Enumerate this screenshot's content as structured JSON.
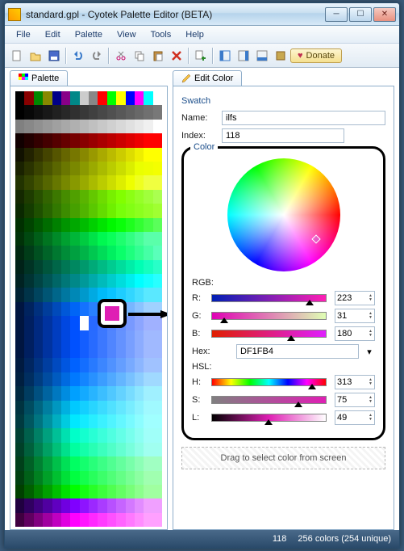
{
  "window": {
    "title": "standard.gpl - Cyotek Palette Editor (BETA)"
  },
  "menu": [
    "File",
    "Edit",
    "Palette",
    "View",
    "Tools",
    "Help"
  ],
  "toolbar": {
    "donate": "Donate"
  },
  "tabs": {
    "palette": "Palette",
    "editcolor": "Edit Color"
  },
  "swatch": {
    "group": "Swatch",
    "name_label": "Name:",
    "name_value": "ilfs",
    "index_label": "Index:",
    "index_value": "118"
  },
  "color": {
    "group": "Color",
    "rgb_label": "RGB:",
    "r_label": "R:",
    "r_value": "223",
    "g_label": "G:",
    "g_value": "31",
    "b_label": "B:",
    "b_value": "180",
    "hex_label": "Hex:",
    "hex_value": "DF1FB4",
    "hsl_label": "HSL:",
    "h_label": "H:",
    "h_value": "313",
    "s_label": "S:",
    "s_value": "75",
    "l_label": "L:",
    "l_value": "49",
    "drag_text": "Drag to select color from screen"
  },
  "status": {
    "index": "118",
    "summary": "256 colors (254 unique)"
  },
  "palette_rows": [
    [
      "#000",
      "#800",
      "#080",
      "#880",
      "#008",
      "#808",
      "#088",
      "#ccc",
      "#888",
      "#f00",
      "#0f0",
      "#ff0",
      "#00f",
      "#f0f",
      "#0ff",
      "#fff"
    ],
    [
      "#000",
      "#080808",
      "#101010",
      "#181818",
      "#202020",
      "#282828",
      "#303030",
      "#383838",
      "#404040",
      "#484848",
      "#505050",
      "#585858",
      "#606060",
      "#686868",
      "#707070",
      "#787878"
    ],
    [
      "#808080",
      "#888",
      "#909090",
      "#989898",
      "#a0a0a0",
      "#a8a8a8",
      "#b0b0b0",
      "#b8b8b8",
      "#c0c0c0",
      "#c8c8c8",
      "#d0d0d0",
      "#d8d8d8",
      "#e0e0e0",
      "#e8e8e8",
      "#f0f0f0",
      "#fff"
    ],
    [
      "#100",
      "#200",
      "#300",
      "#400",
      "#500",
      "#600",
      "#700",
      "#800",
      "#900",
      "#a00",
      "#b00",
      "#c00",
      "#d00",
      "#e00",
      "#f00",
      "#f00"
    ],
    [
      "#110",
      "#220",
      "#330",
      "#440",
      "#550",
      "#660",
      "#770",
      "#880",
      "#990",
      "#aa0",
      "#bb0",
      "#cc0",
      "#dd0",
      "#ee0",
      "#ff0",
      "#ff0"
    ],
    [
      "#1a2200",
      "#2a3300",
      "#3a4400",
      "#4a5500",
      "#5a6600",
      "#6a7700",
      "#7a8800",
      "#8a9900",
      "#9aaa00",
      "#aabb00",
      "#bacc00",
      "#cadd00",
      "#daee00",
      "#eaff00",
      "#efff00",
      "#f4ff00"
    ],
    [
      "#223300",
      "#334400",
      "#445500",
      "#556600",
      "#667700",
      "#778800",
      "#889900",
      "#99aa00",
      "#aabb00",
      "#bbcc00",
      "#ccdd00",
      "#ddee00",
      "#eeff00",
      "#efff20",
      "#f0ff40",
      "#f0ff40"
    ],
    [
      "#142800",
      "#1e3c00",
      "#285000",
      "#326400",
      "#3c7800",
      "#468c00",
      "#50a000",
      "#5ab400",
      "#64c800",
      "#6edc00",
      "#78f000",
      "#82ff00",
      "#8cff14",
      "#96ff28",
      "#a0ff3c",
      "#aaff50"
    ],
    [
      "#0a2800",
      "#143c00",
      "#1e5000",
      "#286400",
      "#327800",
      "#3c8c00",
      "#46a000",
      "#50b400",
      "#5ac800",
      "#64dc00",
      "#6ef000",
      "#78ff0a",
      "#82ff14",
      "#8cff1e",
      "#96ff28",
      "#a0ff32"
    ],
    [
      "#003000",
      "#004400",
      "#005800",
      "#006c00",
      "#008000",
      "#009400",
      "#00a800",
      "#00bc00",
      "#00d000",
      "#00e400",
      "#00f800",
      "#0aff0a",
      "#1eff1e",
      "#32ff32",
      "#46ff46",
      "#5aff5a"
    ],
    [
      "#003208",
      "#004810",
      "#005e18",
      "#007420",
      "#008a28",
      "#00a030",
      "#00b638",
      "#00cc40",
      "#00e248",
      "#00f850",
      "#0aff5a",
      "#1eff6e",
      "#32ff82",
      "#46ff96",
      "#5affaa",
      "#5affaa"
    ],
    [
      "#002810",
      "#003c18",
      "#005020",
      "#006428",
      "#007830",
      "#008c38",
      "#00a040",
      "#00b448",
      "#00c850",
      "#00dc58",
      "#00f060",
      "#0aff6a",
      "#1eff7e",
      "#32ff92",
      "#46ffa6",
      "#5affba"
    ],
    [
      "#002218",
      "#003324",
      "#004430",
      "#00553c",
      "#006648",
      "#007754",
      "#008860",
      "#00996c",
      "#00aa78",
      "#00bb84",
      "#00cc90",
      "#00dd9c",
      "#00eea8",
      "#00ffb4",
      "#14ffbe",
      "#28ffc8"
    ],
    [
      "#002222",
      "#003333",
      "#004444",
      "#005555",
      "#006666",
      "#007777",
      "#008888",
      "#009999",
      "#00aaaa",
      "#00bbbb",
      "#00cccc",
      "#00dddd",
      "#00eeee",
      "#00ffff",
      "#14ffff",
      "#28ffff"
    ],
    [
      "#002233",
      "#003348",
      "#00445e",
      "#005574",
      "#00668a",
      "#0077a0",
      "#0088b6",
      "#0099cc",
      "#00aae2",
      "#00bbf8",
      "#0ac4ff",
      "#1ecdff",
      "#32d6ff",
      "#46dfff",
      "#5ae8ff",
      "#5ae8ff"
    ],
    [
      "#001540",
      "#00235e",
      "#00307d",
      "#003d9b",
      "#004aba",
      "#0058d8",
      "#0065f6",
      "#1472ff",
      "#2880ff",
      "#3c8dff",
      "#509bff",
      "#64a8ff",
      "#78b6ff",
      "#8cc3ff",
      "#a0d1ff",
      "#a0d1ff"
    ],
    [
      "#001540",
      "#001f60",
      "#002980",
      "#0033a0",
      "#003dc0",
      "#0047e0",
      "#0051ff",
      "#145off",
      "#2869ff",
      "#3c75ff",
      "#5081ff",
      "#648dff",
      "#7899ff",
      "#8ca5ff",
      "#a0b1ff",
      "#a0b1ff"
    ],
    [
      "#001540",
      "#001f60",
      "#002980",
      "#0033a0",
      "#003dc0",
      "#0047e0",
      "#0051ff",
      "#145eff",
      "#286bff",
      "#3c78ff",
      "#5085ff",
      "#6492ff",
      "#789fff",
      "#8cacff",
      "#a0b9ff",
      "#a0b9ff"
    ],
    [
      "#001540",
      "#001f60",
      "#002980",
      "#0033a0",
      "#003dc0",
      "#0047e0",
      "#0051ff",
      "#145eff",
      "#286bff",
      "#3c78ff",
      "#5085ff",
      "#6492ff",
      "#789fff",
      "#8cacff",
      "#a0b9ff",
      "#a0b9ff"
    ],
    [
      "#001a40",
      "#002660",
      "#003280",
      "#003ea0",
      "#004ac0",
      "#0056e0",
      "#0062ff",
      "#146eff",
      "#287aff",
      "#3c86ff",
      "#5092ff",
      "#649eff",
      "#78aaff",
      "#8cb6ff",
      "#a0c2ff",
      "#a0c2ff"
    ],
    [
      "#001f40",
      "#002e60",
      "#003d80",
      "#004ca0",
      "#005bc0",
      "#006ae0",
      "#0079ff",
      "#1485ff",
      "#2891ff",
      "#3c9dff",
      "#50a9ff",
      "#64b5ff",
      "#78c1ff",
      "#8ccdff",
      "#a0d9ff",
      "#a0d9ff"
    ],
    [
      "#002840",
      "#003c60",
      "#005080",
      "#0064a0",
      "#0078c0",
      "#008ce0",
      "#00a0ff",
      "#14aaff",
      "#28b4ff",
      "#3cbeff",
      "#50c8ff",
      "#64d2ff",
      "#78dcff",
      "#8ce6ff",
      "#a0f0ff",
      "#a0f0ff"
    ],
    [
      "#003340",
      "#004c60",
      "#006580",
      "#007ea0",
      "#0097c0",
      "#00b0e0",
      "#00c9ff",
      "#14cfff",
      "#28d5ff",
      "#3cdbff",
      "#50e1ff",
      "#64e7ff",
      "#78edff",
      "#8cf3ff",
      "#a0f9ff",
      "#a0f9ff"
    ],
    [
      "#003a40",
      "#005760",
      "#007480",
      "#0091a0",
      "#00aec0",
      "#00cbe0",
      "#00e8ff",
      "#14ebff",
      "#28eeff",
      "#3cf1ff",
      "#50f4ff",
      "#64f7ff",
      "#78faff",
      "#8cfdff",
      "#a0ffff",
      "#a0ffff"
    ],
    [
      "#004033",
      "#00604c",
      "#008065",
      "#00a07e",
      "#00c097",
      "#00e0b0",
      "#00ffc9",
      "#14ffcf",
      "#28ffd5",
      "#3cffdb",
      "#50ffe1",
      "#64ffe7",
      "#78ffed",
      "#8cfff3",
      "#a0fff9",
      "#a0fff9"
    ],
    [
      "#004028",
      "#00603c",
      "#008050",
      "#00a064",
      "#00c078",
      "#00e08c",
      "#00ffa0",
      "#14ffaa",
      "#28ffb4",
      "#3cffbe",
      "#50ffc8",
      "#64ffd2",
      "#78ffdc",
      "#8cffe6",
      "#a0fff0",
      "#a0fff0"
    ],
    [
      "#00401a",
      "#006026",
      "#008032",
      "#00a03e",
      "#00c04a",
      "#00e056",
      "#00ff62",
      "#14ff6e",
      "#28ff7a",
      "#3cff86",
      "#50ff92",
      "#64ff9e",
      "#78ffaa",
      "#8cffb6",
      "#a0ffc2",
      "#a0ffc2"
    ],
    [
      "#004010",
      "#006018",
      "#008020",
      "#00a028",
      "#00c030",
      "#00e038",
      "#00ff40",
      "#14ff4e",
      "#28ff5c",
      "#3cff6a",
      "#50ff78",
      "#64ff86",
      "#78ff94",
      "#8cffa2",
      "#a0ffb0",
      "#a0ffb0"
    ],
    [
      "#004000",
      "#006000",
      "#008000",
      "#00a000",
      "#00c000",
      "#00e000",
      "#00ff00",
      "#14ff14",
      "#28ff28",
      "#3cff3c",
      "#50ff50",
      "#64ff64",
      "#78ff78",
      "#8cff8c",
      "#a0ffa0",
      "#a0ffa0"
    ],
    [
      "#200040",
      "#300060",
      "#400080",
      "#5000a0",
      "#6000c0",
      "#7000e0",
      "#8000ff",
      "#8e14ff",
      "#9c28ff",
      "#aa3cff",
      "#b850ff",
      "#c664ff",
      "#d478ff",
      "#e28cff",
      "#f0a0ff",
      "#f0a0ff"
    ],
    [
      "#400040",
      "#600060",
      "#800080",
      "#a000a0",
      "#c000c0",
      "#e000e0",
      "#ff00ff",
      "#ff14ff",
      "#ff28ff",
      "#ff3cff",
      "#ff50ff",
      "#ff64ff",
      "#ff78ff",
      "#ff8cff",
      "#ffa0ff",
      "#ffa0ff"
    ]
  ]
}
